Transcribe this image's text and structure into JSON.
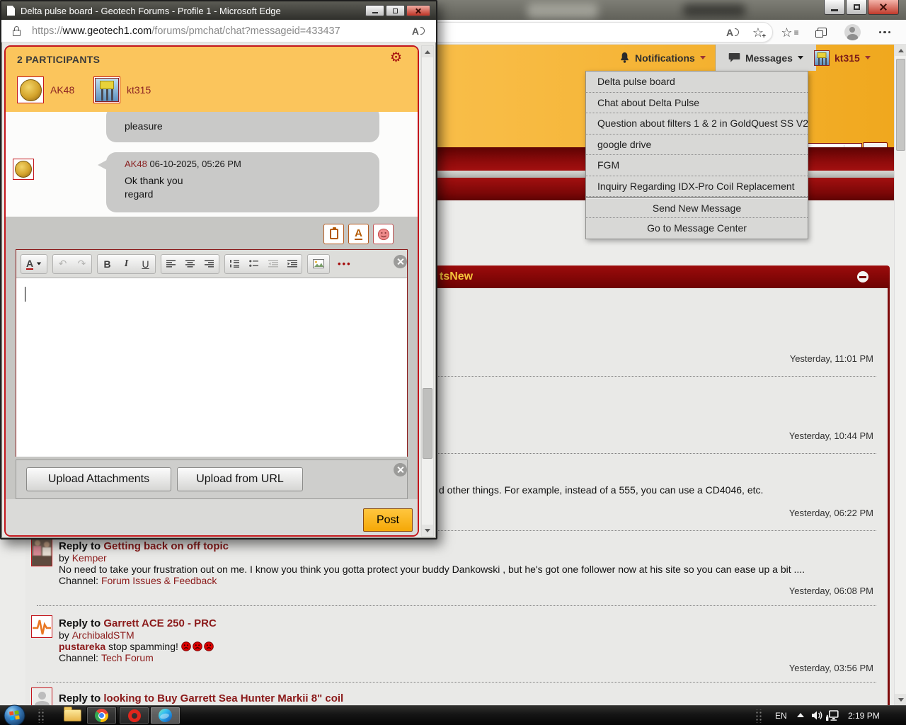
{
  "popup": {
    "window_title": "Delta pulse board - Geotech Forums - Profile 1 - Microsoft Edge",
    "url_scheme": "https://",
    "url_domain": "www.geotech1.com",
    "url_path": "/forums/pmchat/chat?messageid=433437",
    "participants_header": "2 PARTICIPANTS",
    "participant1": "AK48",
    "participant2": "kt315",
    "older_message": "pleasure",
    "message_author": "AK48",
    "message_time": "06-10-2025, 05:26 PM",
    "message_line1": "Ok thank you",
    "message_line2": "regard",
    "upload_attachments": "Upload Attachments",
    "upload_from_url": "Upload from URL",
    "post_label": "Post"
  },
  "editor": {
    "font": "A",
    "bold": "B",
    "italic": "I",
    "underline": "U",
    "more": "•••",
    "format_a": "A"
  },
  "icons": {
    "gear": "⚙",
    "star": "☆",
    "menu_lines": "≡",
    "undo": "↶",
    "redo": "↷",
    "read_aloud": "A",
    "plus": "+"
  },
  "main": {
    "notifications": "Notifications",
    "messages": "Messages",
    "username": "kt315",
    "menu": {
      "item1": "Delta pulse board",
      "item2": "Chat about Delta Pulse",
      "item3": "Question about filters 1 & 2 in GoldQuest SS V2",
      "item4": "google drive",
      "item5": "FGM",
      "item6": "Inquiry Regarding IDX-Pro Coil Replacement",
      "send_new": "Send New Message",
      "go_center": "Go to Message Center"
    },
    "section_title": "tsNew",
    "labels": {
      "reply": "Reply to",
      "by": "by",
      "channel": "Channel:"
    },
    "posts": {
      "t1": "Yesterday, 11:01 PM",
      "t2": "Yesterday, 10:44 PM",
      "frag3": "d other things. For example, instead of a 555, you can use a CD4046, etc.",
      "t3": "Yesterday, 06:22 PM",
      "title4": "Getting back on off topic",
      "author4": "Kemper",
      "body4": "No need to take your frustration out on me. I know you think you gotta protect your buddy Dankowski , but he's got one follower now at his site so you can ease up a bit ....",
      "channel4": "Forum Issues & Feedback",
      "t4": "Yesterday, 06:08 PM",
      "title5": "Garrett ACE 250 - PRC",
      "author5": "ArchibaldSTM",
      "lead5": "pustareka",
      "body5": "stop spamming!",
      "channel5": "Tech Forum",
      "t5": "Yesterday, 03:56 PM",
      "title6": "looking to Buy Garrett Sea Hunter Markii 8\" coil"
    }
  },
  "taskbar": {
    "language": "EN",
    "time": "2:19 PM"
  },
  "colors": {
    "header_orange": "#FBC55C",
    "maroon_banner": "#8B0000",
    "link_red": "#8B1A1A",
    "post_button_amber": "#F5A806"
  }
}
